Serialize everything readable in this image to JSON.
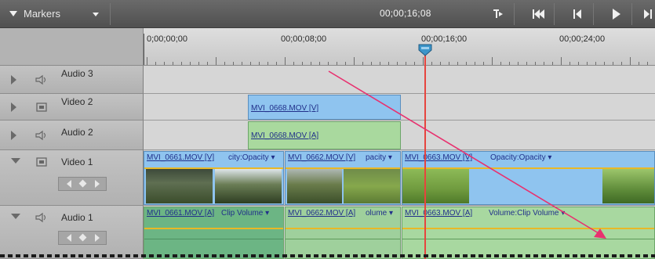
{
  "toolbar": {
    "markers_label": "Markers",
    "current_time": "00;00;16;08"
  },
  "ruler": {
    "labels": [
      "0;00;00;00",
      "00;00;08;00",
      "00;00;16;00",
      "00;00;24;00"
    ]
  },
  "tracks": [
    {
      "name": "Audio 3",
      "type": "audio"
    },
    {
      "name": "Video 2",
      "type": "video"
    },
    {
      "name": "Audio 2",
      "type": "audio"
    },
    {
      "name": "Video 1",
      "type": "video"
    },
    {
      "name": "Audio 1",
      "type": "audio"
    }
  ],
  "clips": {
    "v2": "MVI_0668.MOV [V]",
    "a2": "MVI_0668.MOV [A]",
    "v1a": "MVI_0661.MOV [V]",
    "v1a_fx": "city:Opacity ▾",
    "v1b": "MVI_0662.MOV [V]",
    "v1b_fx": "pacity ▾",
    "v1c": "MVI_0663.MOV [V]",
    "v1c_fx": "Opacity:Opacity ▾",
    "a1a": "MVI_0661.MOV [A]",
    "a1a_fx": "Clip Volume ▾",
    "a1b": "MVI_0662.MOV [A]",
    "a1b_fx": "olume ▾",
    "a1c": "MVI_0663.MOV [A]",
    "a1c_fx": "Volume:Clip Volume ▾"
  },
  "colors": {
    "video_clip": "#8fc4ef",
    "audio_clip": "#a9d99e",
    "playhead": "#e6443e",
    "arrow": "#e8316f",
    "opacity_line": "#e9b826"
  },
  "icons": {
    "expand": "triangle-right-icon",
    "speaker": "speaker-icon",
    "film": "film-icon",
    "set_in": "set-in-icon",
    "go_start": "go-to-start-icon",
    "step_back": "step-back-icon",
    "play": "play-icon",
    "step_fwd": "step-forward-icon"
  }
}
